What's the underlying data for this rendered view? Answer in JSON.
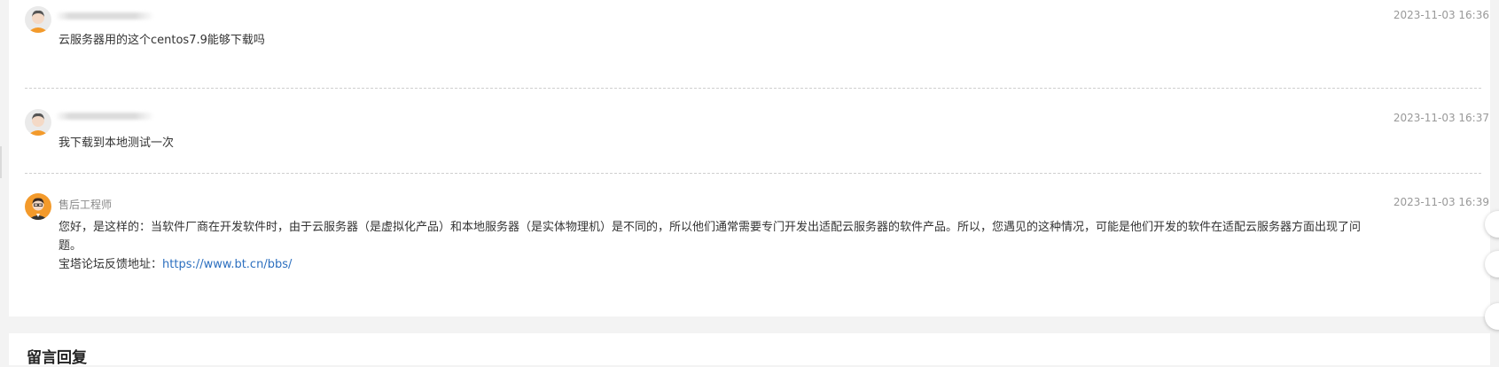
{
  "comments": [
    {
      "username": "",
      "time": "2023-11-03 16:36",
      "content": "云服务器用的这个centos7.9能够下载吗"
    },
    {
      "username": "",
      "time": "2023-11-03 16:37",
      "content": "我下载到本地测试一次"
    },
    {
      "username": "售后工程师",
      "time": "2023-11-03 16:39",
      "content_line1": "您好，是这样的：当软件厂商在开发软件时，由于云服务器（是虚拟化产品）和本地服务器（是实体物理机）是不同的，所以他们通常需要专门开发出适配云服务器的软件产品。所以，您遇见的这种情况，可能是他们开发的软件在适配云服务器方面出现了问",
      "content_line2": "题。",
      "forum_label": "宝塔论坛反馈地址：",
      "forum_link": "https://www.bt.cn/bbs/"
    }
  ],
  "reply_section": {
    "title": "留言回复"
  },
  "icons": {
    "user_avatar": "user-avatar-icon",
    "engineer_avatar": "engineer-avatar-icon"
  },
  "colors": {
    "link": "#2c6fbf",
    "avatar_orange": "#f39a2b"
  }
}
